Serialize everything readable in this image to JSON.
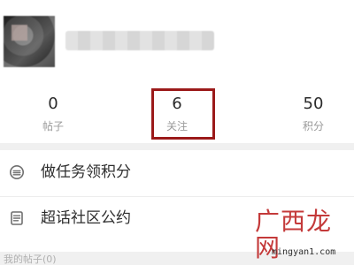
{
  "stats": {
    "posts": {
      "value": "0",
      "label": "帖子"
    },
    "following": {
      "value": "6",
      "label": "关注"
    },
    "points": {
      "value": "50",
      "label": "积分"
    }
  },
  "menu": [
    {
      "label": "做任务领积分",
      "icon": "coin-stack-icon"
    },
    {
      "label": "超话社区公约",
      "icon": "document-icon"
    }
  ],
  "section": {
    "title": "我的帖子(0)"
  },
  "watermark": {
    "text": "广西龙网",
    "url": "mingyan1.com"
  },
  "colors": {
    "highlight": "#9b1a1a",
    "watermark": "#c43a3a"
  }
}
